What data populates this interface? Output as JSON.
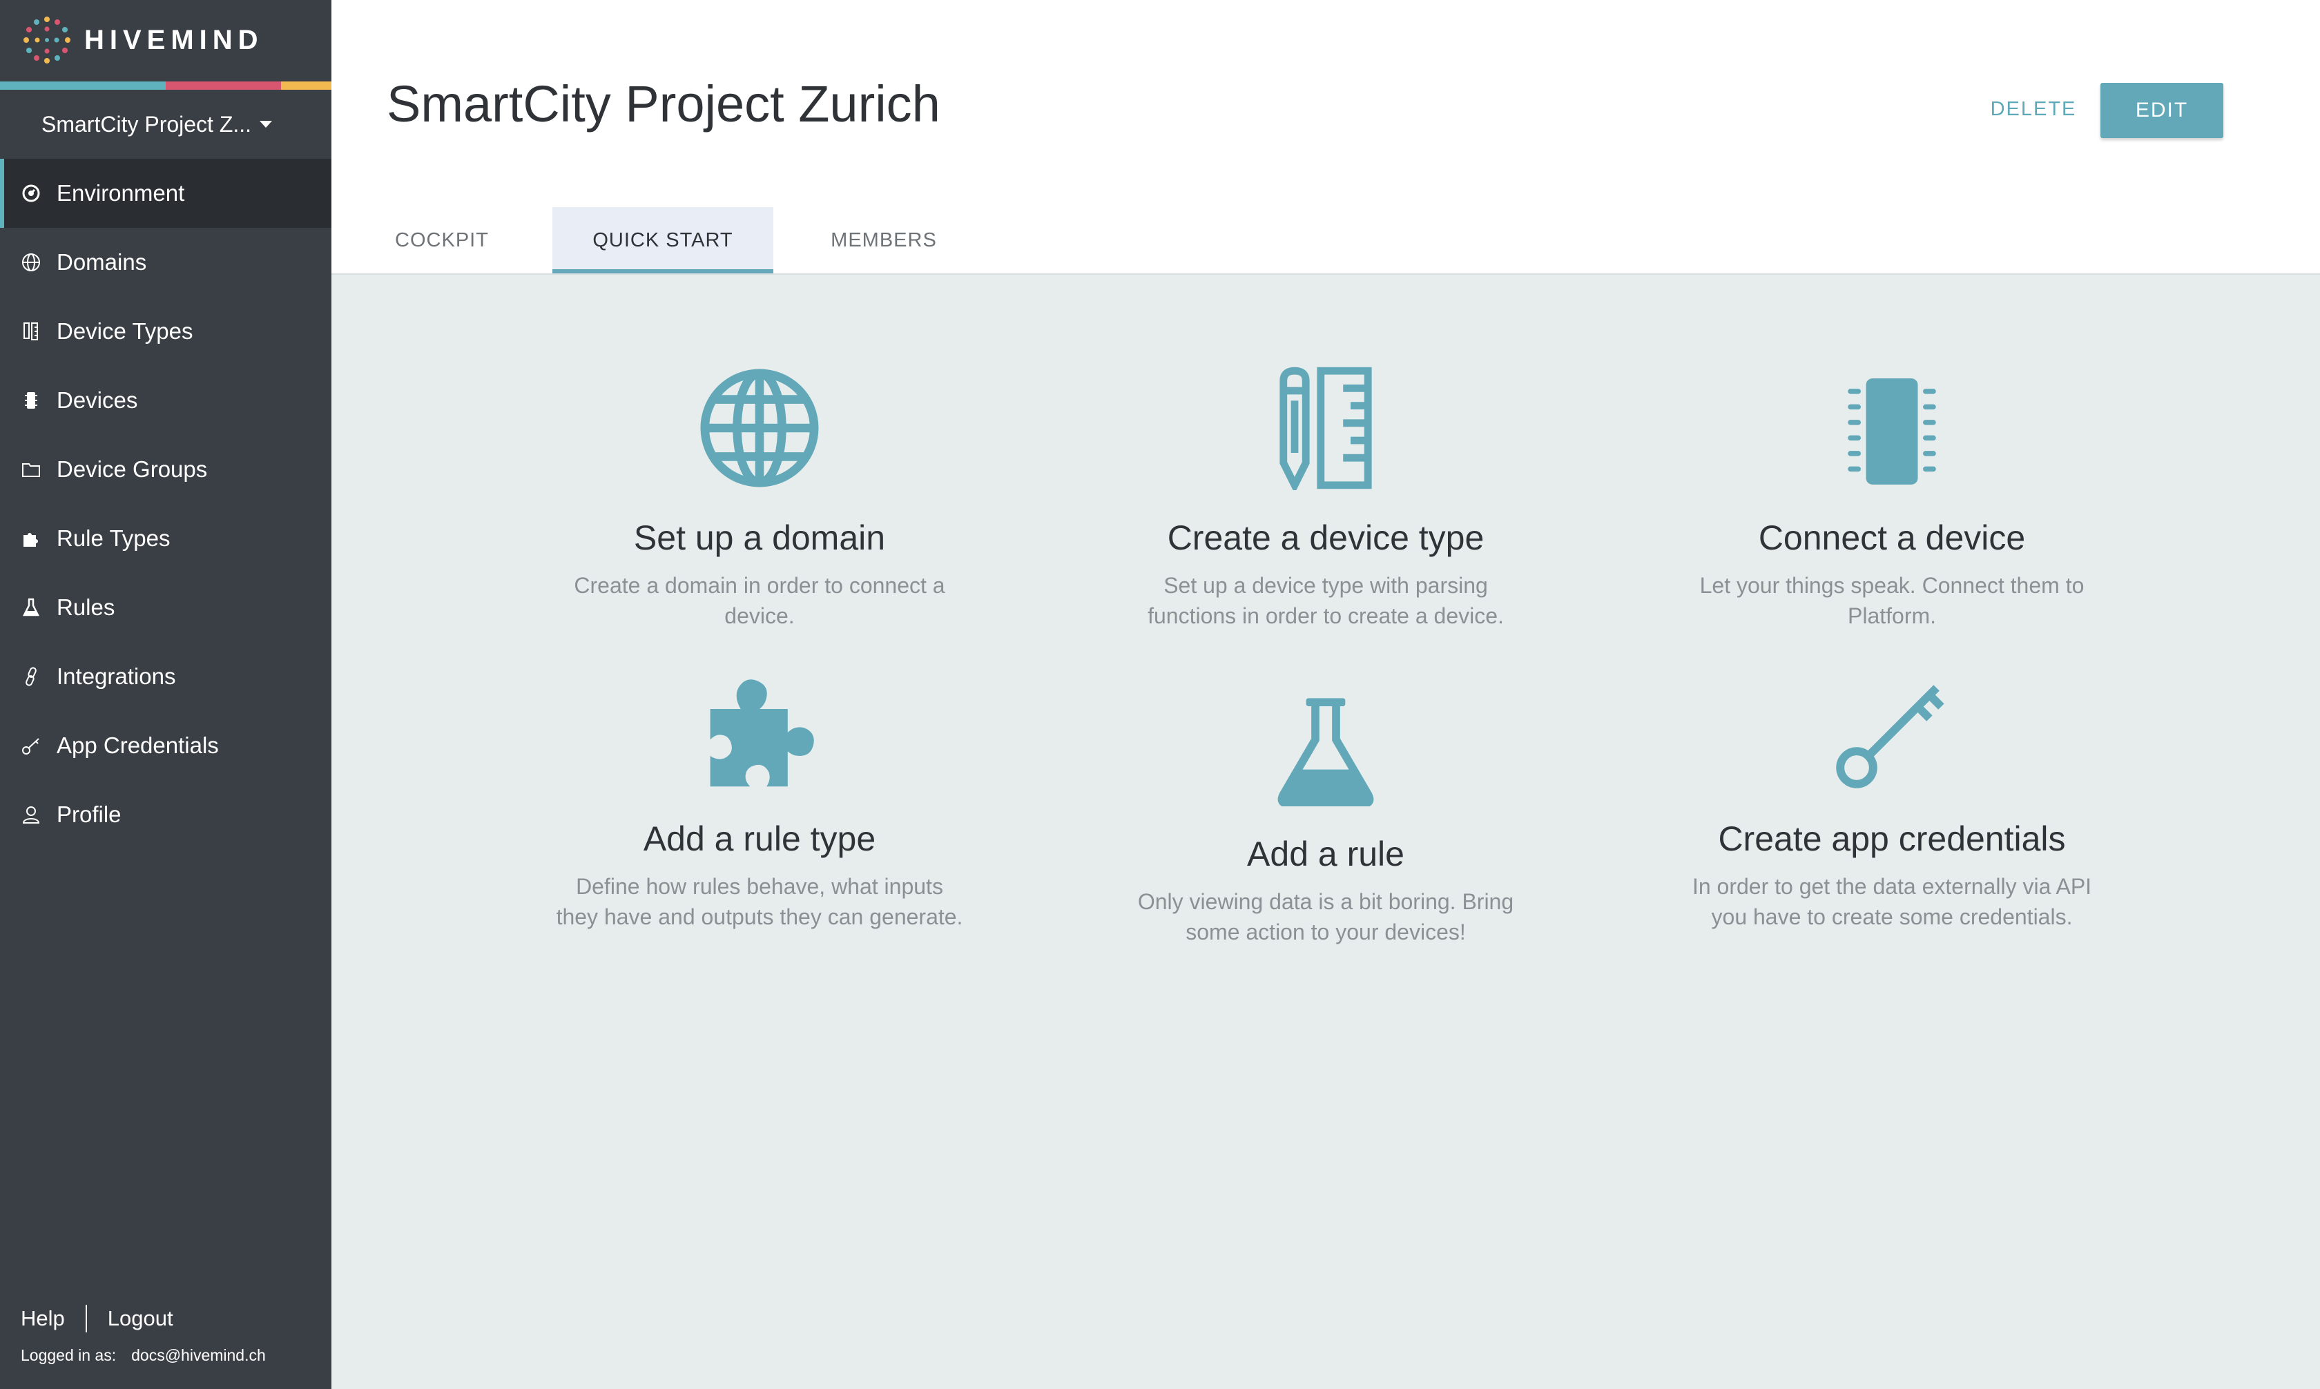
{
  "brand": {
    "name": "HIVEMIND",
    "stripe_colors": [
      "#5eb3bd",
      "#d8566f",
      "#f2b950"
    ]
  },
  "sidebar": {
    "project_selector": "SmartCity Project Z...",
    "items": [
      {
        "label": "Environment",
        "icon": "environment-icon",
        "active": true
      },
      {
        "label": "Domains",
        "icon": "globe-icon"
      },
      {
        "label": "Device Types",
        "icon": "device-type-icon"
      },
      {
        "label": "Devices",
        "icon": "chip-icon"
      },
      {
        "label": "Device Groups",
        "icon": "folder-icon"
      },
      {
        "label": "Rule Types",
        "icon": "puzzle-icon"
      },
      {
        "label": "Rules",
        "icon": "flask-icon"
      },
      {
        "label": "Integrations",
        "icon": "link-icon"
      },
      {
        "label": "App Credentials",
        "icon": "key-icon"
      },
      {
        "label": "Profile",
        "icon": "user-icon"
      }
    ],
    "footer": {
      "help": "Help",
      "logout": "Logout",
      "logged_in_label": "Logged in as:",
      "user_email": "docs@hivemind.ch"
    }
  },
  "header": {
    "title": "SmartCity Project Zurich",
    "delete_label": "DELETE",
    "edit_label": "EDIT",
    "tabs": [
      {
        "label": "COCKPIT"
      },
      {
        "label": "QUICK START",
        "active": true
      },
      {
        "label": "MEMBERS"
      }
    ]
  },
  "quick_start": {
    "cards": [
      {
        "icon": "globe-icon",
        "title": "Set up a domain",
        "description": "Create a domain in order to connect a device."
      },
      {
        "icon": "pencil-ruler-icon",
        "title": "Create a device type",
        "description": "Set up a device type with parsing functions in order to create a device."
      },
      {
        "icon": "chip-icon",
        "title": "Connect a device",
        "description": "Let your things speak. Connect them to Platform."
      },
      {
        "icon": "puzzle-icon",
        "title": "Add a rule type",
        "description": "Define how rules behave, what inputs they have and outputs they can generate."
      },
      {
        "icon": "flask-icon",
        "title": "Add a rule",
        "description": "Only viewing data is a bit boring. Bring some action to your devices!"
      },
      {
        "icon": "key-icon",
        "title": "Create app credentials",
        "description": "In order to get the data externally via API you have to create some credentials."
      }
    ]
  },
  "colors": {
    "accent": "#62a8b8",
    "sidebar_bg": "#3a3f45",
    "sidebar_active_bg": "#2a2d31",
    "content_bg": "#e7edec"
  }
}
